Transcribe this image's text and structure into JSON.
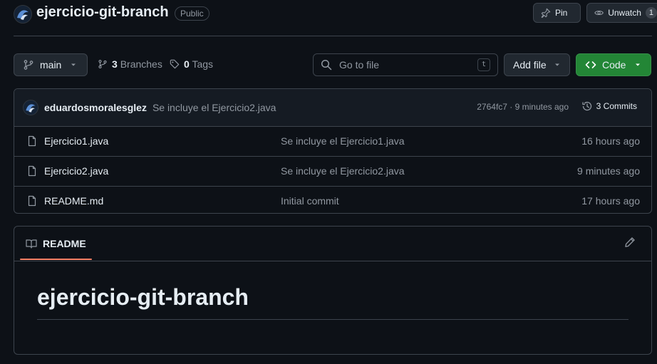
{
  "repo": {
    "name": "ejercicio-git-branch",
    "visibility": "Public",
    "pin_label": "Pin",
    "unwatch_label": "Unwatch",
    "watch_count": "1"
  },
  "toolbar": {
    "branch": "main",
    "branches_count": "3",
    "branches_label": "Branches",
    "tags_count": "0",
    "tags_label": "Tags",
    "search_placeholder": "Go to file",
    "search_shortcut": "t",
    "add_file_label": "Add file",
    "code_label": "Code"
  },
  "latest_commit": {
    "author": "eduardosmoralesglez",
    "message": "Se incluye el Ejercicio2.java",
    "meta": "2764fc7 · 9 minutes ago",
    "commits_label": "3 Commits"
  },
  "files": [
    {
      "name": "Ejercicio1.java",
      "message": "Se incluye el Ejercicio1.java",
      "date": "16 hours ago"
    },
    {
      "name": "Ejercicio2.java",
      "message": "Se incluye el Ejercicio2.java",
      "date": "9 minutes ago"
    },
    {
      "name": "README.md",
      "message": "Initial commit",
      "date": "17 hours ago"
    }
  ],
  "readme": {
    "tab_label": "README",
    "heading": "ejercicio-git-branch"
  },
  "colors": {
    "background": "#0d1117",
    "border": "#3d444d",
    "code_button": "#238636",
    "tab_underline": "#f78166",
    "muted_text": "#9198a1"
  },
  "icons": [
    "avatar-icon",
    "pin-icon",
    "eye-icon",
    "branch-icon",
    "tag-icon",
    "search-icon",
    "caret-down-icon",
    "code-icon",
    "history-icon",
    "file-icon",
    "book-icon",
    "pencil-icon"
  ]
}
